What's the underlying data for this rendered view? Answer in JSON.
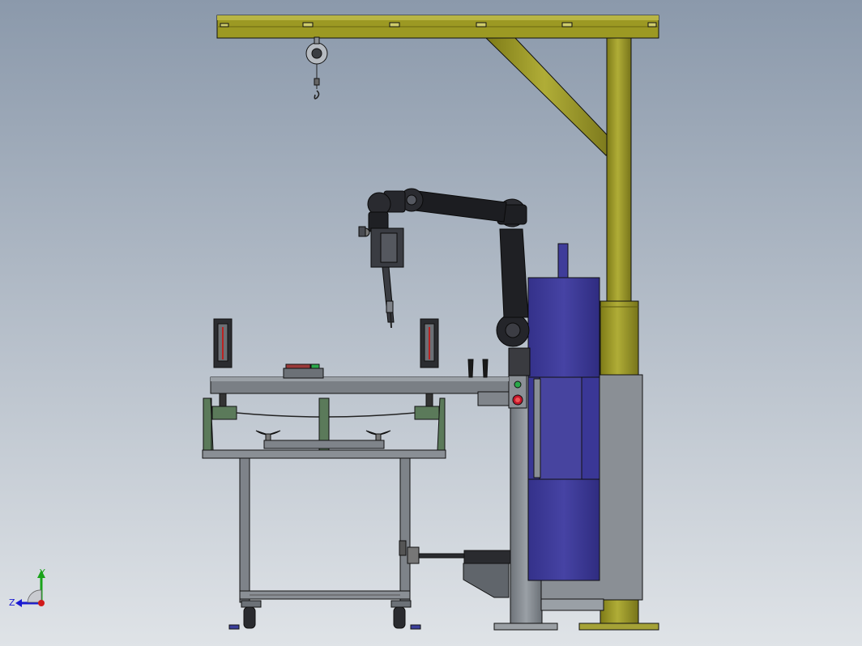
{
  "viewport": {
    "background_top": "#8b99ab",
    "background_bottom": "#dfe3e7"
  },
  "colors": {
    "crane_yellow": "#8f8c1e",
    "crane_yellow_light": "#b3b03a",
    "frame_gray": "#7d8288",
    "frame_dark": "#505459",
    "robot_black": "#1d1e22",
    "robot_joint": "#2c2d32",
    "controller_blue": "#3b3897",
    "controller_blue_light": "#5050b0",
    "fixture_green": "#5b7a5a",
    "status_green": "#2aa84a",
    "status_red": "#c4162b",
    "outline": "#111111"
  },
  "triad": {
    "x_label": "",
    "y_label": "Y",
    "z_label": "Z",
    "x_color": "#d11a1a",
    "y_color": "#1aa31a",
    "z_color": "#1a1ad1"
  }
}
